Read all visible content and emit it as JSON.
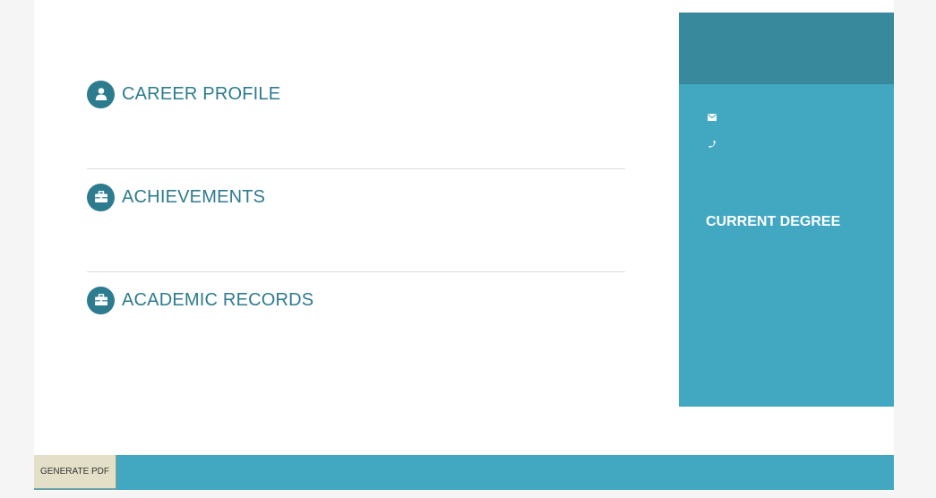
{
  "sections": [
    {
      "label": "CAREER PROFILE",
      "icon": "user-icon"
    },
    {
      "label": "ACHIEVEMENTS",
      "icon": "briefcase-icon"
    },
    {
      "label": "ACADEMIC RECORDS",
      "icon": "briefcase-icon"
    }
  ],
  "sidebar": {
    "email_icon": "envelope-icon",
    "phone_icon": "phone-icon",
    "degree_label": "CURRENT DEGREE"
  },
  "footer": {
    "button_label": "GENERATE PDF"
  },
  "colors": {
    "accent": "#2d7b8e",
    "sidebar_bg": "#42a8c1",
    "sidebar_header": "#37899b",
    "button_bg": "#e4e0c8"
  }
}
